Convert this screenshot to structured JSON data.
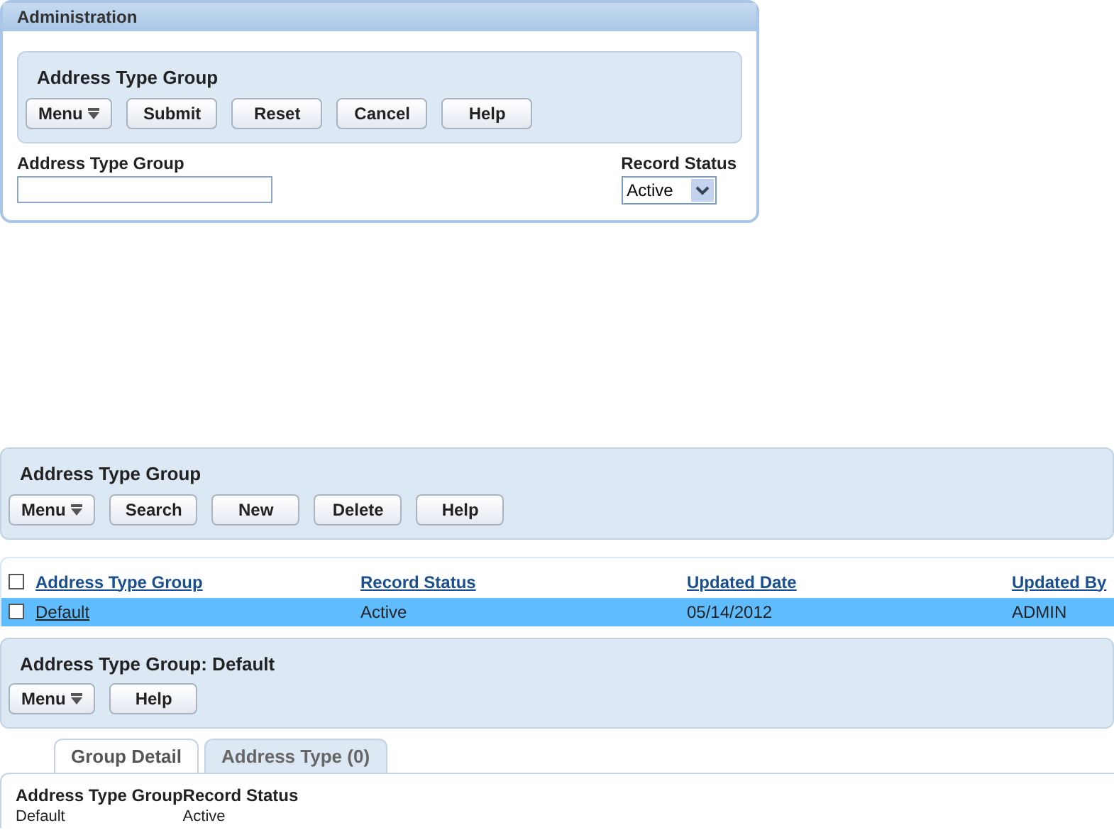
{
  "search_panel": {
    "title": "Administration",
    "toolbar_title": "Address Type Group",
    "buttons": [
      {
        "label": "Menu",
        "kind": "menu"
      },
      {
        "label": "Submit",
        "kind": "plain"
      },
      {
        "label": "Reset",
        "kind": "plain"
      },
      {
        "label": "Cancel",
        "kind": "plain"
      },
      {
        "label": "Help",
        "kind": "plain"
      }
    ],
    "fields": [
      {
        "label": "Address Type Group",
        "kind": "text"
      },
      {
        "label": "Record Status",
        "kind": "select",
        "value": "Active"
      }
    ]
  },
  "results_panel": {
    "title": "Address Type Group",
    "buttons": [
      {
        "label": "Menu",
        "kind": "menu"
      },
      {
        "label": "Search",
        "kind": "plain"
      },
      {
        "label": "New",
        "kind": "plain"
      },
      {
        "label": "Delete",
        "kind": "plain"
      },
      {
        "label": "Help",
        "kind": "plain"
      }
    ]
  },
  "table": {
    "select_all_checked": false,
    "columns": [
      "Address Type Group",
      "Record Status",
      "Updated Date",
      "Updated By"
    ],
    "rows": [
      {
        "selected": true,
        "checked": false,
        "cells": [
          "Default",
          "Active",
          "05/14/2012",
          "ADMIN"
        ]
      }
    ]
  },
  "detail_panel": {
    "title": "Address Type Group: Default",
    "buttons": [
      {
        "label": "Menu",
        "kind": "menu"
      },
      {
        "label": "Help",
        "kind": "plain"
      }
    ]
  },
  "tabs": [
    {
      "label": "Group Detail",
      "selected": true
    },
    {
      "label": "Address Type (0)",
      "selected": false
    }
  ],
  "detail": [
    {
      "label": "Address Type Group",
      "value": "Default"
    },
    {
      "label": "Record Status",
      "value": "Active"
    }
  ]
}
